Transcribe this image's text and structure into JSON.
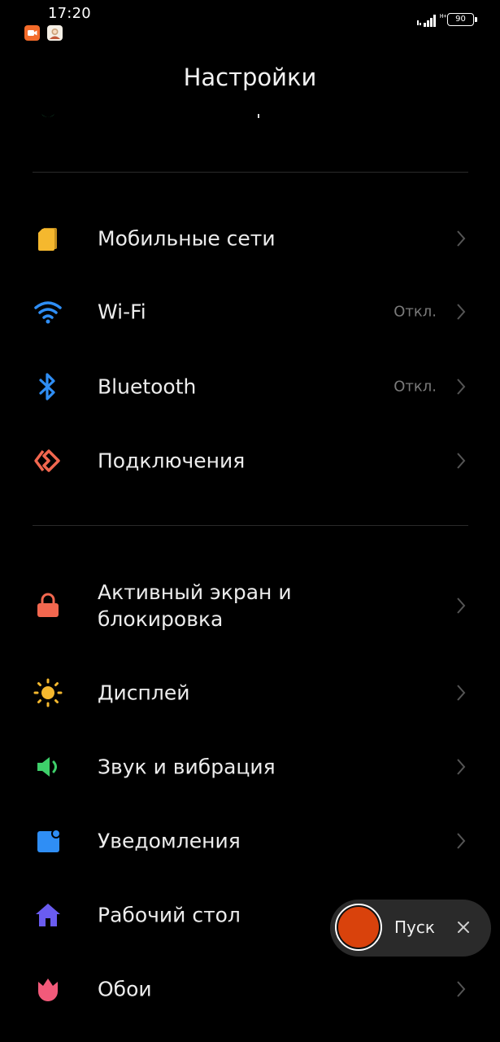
{
  "status_bar": {
    "time": "17:20",
    "network_type": "H+",
    "battery_level": "90",
    "notification_icons": [
      "screen-recorder-icon",
      "app-avatar-icon"
    ]
  },
  "header": {
    "title": "Настройки"
  },
  "sections": [
    {
      "items": [
        {
          "label": "Мобильные сети",
          "value": "",
          "icon": "sim-card-icon",
          "color": "#f5b82e"
        },
        {
          "label": "Wi-Fi",
          "value": "Откл.",
          "icon": "wifi-icon",
          "color": "#2f8ef5"
        },
        {
          "label": "Bluetooth",
          "value": "Откл.",
          "icon": "bluetooth-icon",
          "color": "#2f8ef5"
        },
        {
          "label": "Подключения",
          "value": "",
          "icon": "connections-icon",
          "color": "#f2674f"
        }
      ]
    },
    {
      "items": [
        {
          "label": "Активный экран и блокировка",
          "value": "",
          "icon": "lock-icon",
          "color": "#f2674f"
        },
        {
          "label": "Дисплей",
          "value": "",
          "icon": "sun-icon",
          "color": "#f5b82e"
        },
        {
          "label": "Звук и вибрация",
          "value": "",
          "icon": "speaker-icon",
          "color": "#3ecf6a"
        },
        {
          "label": "Уведомления",
          "value": "",
          "icon": "notification-icon",
          "color": "#2f8ef5"
        },
        {
          "label": "Рабочий стол",
          "value": "",
          "icon": "home-icon",
          "color": "#6a5cf0"
        },
        {
          "label": "Обои",
          "value": "",
          "icon": "tulip-icon",
          "color": "#f25a7a"
        }
      ]
    }
  ],
  "recorder_widget": {
    "start_label": "Пуск"
  }
}
